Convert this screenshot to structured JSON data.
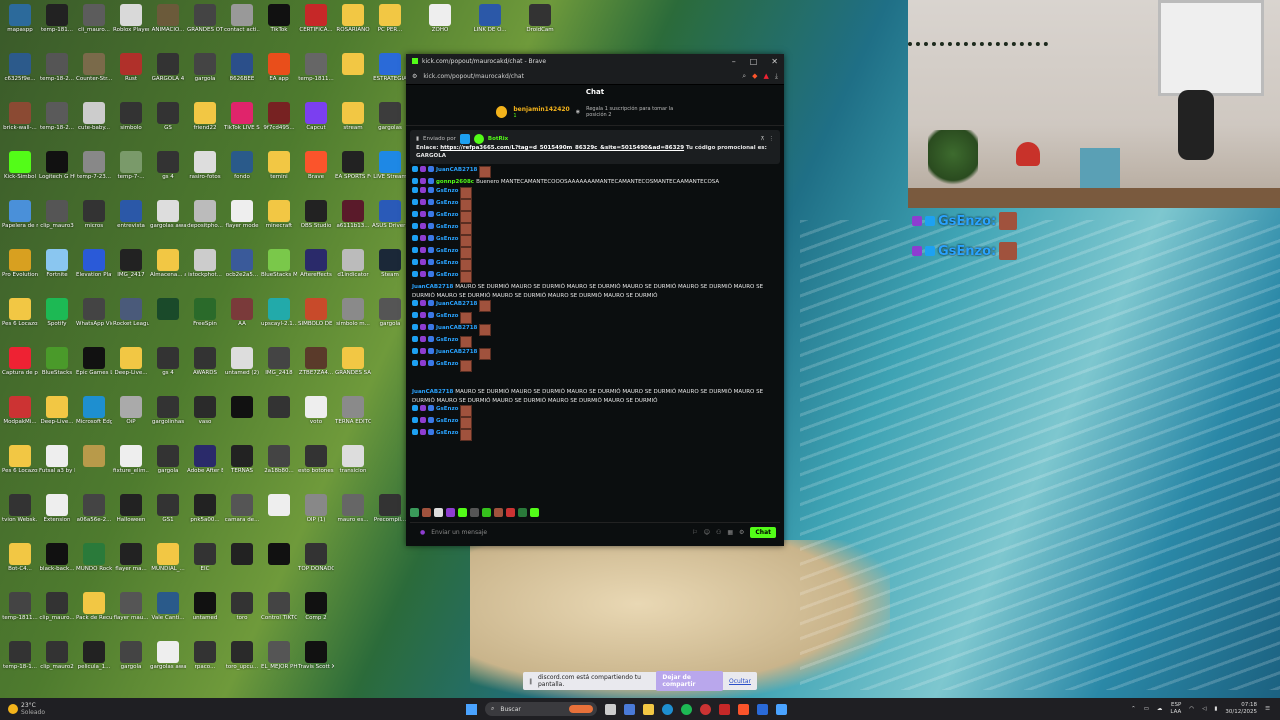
{
  "desktop_icons": [
    {
      "label": "mapaspp",
      "color": "#2c6a9b"
    },
    {
      "label": "temp-181...",
      "color": "#222"
    },
    {
      "label": "cli_mauro...",
      "color": "#5c5c5c"
    },
    {
      "label": "Roblox Player",
      "color": "#d9d9d9"
    },
    {
      "label": "ANIMACIO...",
      "color": "#6b5a3a"
    },
    {
      "label": "GRANDES OTRAS AWARD",
      "color": "#444"
    },
    {
      "label": "contact acti...",
      "color": "#999"
    },
    {
      "label": "TikTok",
      "color": "#111"
    },
    {
      "label": "CERTIFICA...",
      "color": "#c62828"
    },
    {
      "label": "ROSARIANO",
      "color": "#f2c744"
    },
    {
      "label": "PC PER...",
      "color": "#f2c744"
    },
    {
      "label": "ZOHO",
      "color": "#eee"
    },
    {
      "label": "LINK DE O...",
      "color": "#2b58a8"
    },
    {
      "label": "DroidCam",
      "color": "#333"
    },
    {
      "label": "c6325f9e...",
      "color": "#2c5a8b"
    },
    {
      "label": "temp-18-2...",
      "color": "#555"
    },
    {
      "label": "Counter-Str...",
      "color": "#7a6a4a"
    },
    {
      "label": "Rust",
      "color": "#b0302a"
    },
    {
      "label": "GARGOLA 4",
      "color": "#333"
    },
    {
      "label": "gargola",
      "color": "#444"
    },
    {
      "label": "8626BEE",
      "color": "#2b4f8a"
    },
    {
      "label": "EA app",
      "color": "#e94e1b"
    },
    {
      "label": "temp-1811...",
      "color": "#666"
    },
    {
      "label": "",
      "color": "#f2c744"
    },
    {
      "label": "ESTRATEGIA",
      "color": "#2a6ad8"
    },
    {
      "label": "brick-wall-...",
      "color": "#8b4a33"
    },
    {
      "label": "temp-18-2...",
      "color": "#5a5a5a"
    },
    {
      "label": "cute-baby...",
      "color": "#ccc"
    },
    {
      "label": "simbolo",
      "color": "#333"
    },
    {
      "label": "GS",
      "color": "#333"
    },
    {
      "label": "friend22",
      "color": "#f2c744"
    },
    {
      "label": "TikTok LIVE Studio",
      "color": "#e0246b"
    },
    {
      "label": "9f7cd495...",
      "color": "#722"
    },
    {
      "label": "Capcut",
      "color": "#7b3ff0"
    },
    {
      "label": "stream",
      "color": "#f2c744"
    },
    {
      "label": "gargolas",
      "color": "#3c3c3c"
    },
    {
      "label": "Kick-Simbol",
      "color": "#53fc18"
    },
    {
      "label": "Logitech G HUB",
      "color": "#111"
    },
    {
      "label": "temp-7-23...",
      "color": "#888"
    },
    {
      "label": "temp-7-...",
      "color": "#7a9a6a"
    },
    {
      "label": "gs 4",
      "color": "#333"
    },
    {
      "label": "rasiro-fotos",
      "color": "#ddd"
    },
    {
      "label": "fondo",
      "color": "#2a5a8a"
    },
    {
      "label": "temini",
      "color": "#f2c744"
    },
    {
      "label": "Brave",
      "color": "#fb542b"
    },
    {
      "label": "EA SPORTS FC 25",
      "color": "#222"
    },
    {
      "label": "LIVE Stream",
      "color": "#1e88e5"
    },
    {
      "label": "Papelera de reciclaje",
      "color": "#4a90d9"
    },
    {
      "label": "clip_mauro3",
      "color": "#555"
    },
    {
      "label": "micros",
      "color": "#333"
    },
    {
      "label": "entrevista",
      "color": "#2b58a8"
    },
    {
      "label": "gargolas awards",
      "color": "#ddd"
    },
    {
      "label": "depositpho...",
      "color": "#bbb"
    },
    {
      "label": "flayer mode",
      "color": "#eee"
    },
    {
      "label": "minecraft",
      "color": "#f2c744"
    },
    {
      "label": "OBS Studio",
      "color": "#222"
    },
    {
      "label": "a6111b13...",
      "color": "#5a1a2a"
    },
    {
      "label": "ASUS DriverHub",
      "color": "#2a5ab8"
    },
    {
      "label": "Pro Evolution Soccer 6",
      "color": "#d8a020"
    },
    {
      "label": "Fortnite",
      "color": "#8ac6f0"
    },
    {
      "label": "Elevation Player",
      "color": "#2a5ad8"
    },
    {
      "label": "IMG_2417",
      "color": "#222"
    },
    {
      "label": "Almacena... automatic...",
      "color": "#f2c744"
    },
    {
      "label": "istockphot...",
      "color": "#ccc"
    },
    {
      "label": "ocb2e2a5...",
      "color": "#3a5a9a"
    },
    {
      "label": "BlueStacks Multi-Insta...",
      "color": "#7ac84a"
    },
    {
      "label": "Aftereffects",
      "color": "#2a2a6a"
    },
    {
      "label": "d1indicator",
      "color": "#bbb"
    },
    {
      "label": "Steam",
      "color": "#1b2838"
    },
    {
      "label": "Pes 6 Locazos",
      "color": "#f2c744"
    },
    {
      "label": "Spotify",
      "color": "#1db954"
    },
    {
      "label": "WhatsApp Video 2025...",
      "color": "#444"
    },
    {
      "label": "Rocket League",
      "color": "#4a5a7a"
    },
    {
      "label": "",
      "color": "#1a4a2a"
    },
    {
      "label": "FreeSpin",
      "color": "#2a6a2a"
    },
    {
      "label": "AA",
      "color": "#7a3a3a"
    },
    {
      "label": "upscayl-2.1...",
      "color": "#2aa"
    },
    {
      "label": "SIMBOLO DE GARGOLA",
      "color": "#c84a2a"
    },
    {
      "label": "simbolo m...",
      "color": "#8a8a8a"
    },
    {
      "label": "gargola",
      "color": "#555"
    },
    {
      "label": "Captura de pantalla 2...",
      "color": "#e23"
    },
    {
      "label": "BlueStacks",
      "color": "#4a9a2a"
    },
    {
      "label": "Epic Games Launcher",
      "color": "#111"
    },
    {
      "label": "Deep-Live...",
      "color": "#f2c744"
    },
    {
      "label": "gs 4",
      "color": "#333"
    },
    {
      "label": "AWARDS",
      "color": "#333"
    },
    {
      "label": "untamed (2)",
      "color": "#ddd"
    },
    {
      "label": "IMG_2418",
      "color": "#444"
    },
    {
      "label": "ZTBE7ZA4...",
      "color": "#5a3a2a"
    },
    {
      "label": "GRANDES SALVAJES",
      "color": "#f2c744"
    },
    {
      "label": "ModpakMi...",
      "color": "#c33"
    },
    {
      "label": "Deep-Live...",
      "color": "#f2c744"
    },
    {
      "label": "Microsoft Edge",
      "color": "#1e8fd0"
    },
    {
      "label": "OiP",
      "color": "#aaa"
    },
    {
      "label": "gargolinhas",
      "color": "#333"
    },
    {
      "label": "vaso",
      "color": "#2a2a2a"
    },
    {
      "label": "",
      "color": "#111"
    },
    {
      "label": "",
      "color": "#333"
    },
    {
      "label": "voto",
      "color": "#eee"
    },
    {
      "label": "TERNA EDITORIA",
      "color": "#8a8a8a"
    },
    {
      "label": "Pes 6 Locazos",
      "color": "#f2c744"
    },
    {
      "label": "Futsal a3 by Bazinga Fro...",
      "color": "#eee"
    },
    {
      "label": "",
      "color": "#b89a4a"
    },
    {
      "label": "fixture_elim...",
      "color": "#eee"
    },
    {
      "label": "gargola",
      "color": "#333"
    },
    {
      "label": "Adobe After Effects",
      "color": "#2a2a6a"
    },
    {
      "label": "TERNAS",
      "color": "#222"
    },
    {
      "label": "2a18b80...",
      "color": "#444"
    },
    {
      "label": "esto botones ...",
      "color": "#333"
    },
    {
      "label": "transicion",
      "color": "#ddd"
    },
    {
      "label": "tvion Websk...",
      "color": "#333"
    },
    {
      "label": "Extension",
      "color": "#eee"
    },
    {
      "label": "a06a56e-2...",
      "color": "#444"
    },
    {
      "label": "Halloween",
      "color": "#222"
    },
    {
      "label": "GS1",
      "color": "#333"
    },
    {
      "label": "pnk5a00...",
      "color": "#222"
    },
    {
      "label": "camara de...",
      "color": "#555"
    },
    {
      "label": "",
      "color": "#eee"
    },
    {
      "label": "OIP (1)",
      "color": "#888"
    },
    {
      "label": "mauro es...",
      "color": "#666"
    },
    {
      "label": "Precompil...",
      "color": "#333"
    },
    {
      "label": "Bot-C4...",
      "color": "#f2c744"
    },
    {
      "label": "black-back...",
      "color": "#111"
    },
    {
      "label": "MUNDO Rocket...",
      "color": "#2a7a3a"
    },
    {
      "label": "flayer ma...",
      "color": "#222"
    },
    {
      "label": "MUNDIAL_...",
      "color": "#f2c744"
    },
    {
      "label": "EIC",
      "color": "#333"
    },
    {
      "label": "",
      "color": "#222"
    },
    {
      "label": "",
      "color": "#111"
    },
    {
      "label": "TOP DONADO...",
      "color": "#333"
    },
    {
      "label": "temp-1811...",
      "color": "#444"
    },
    {
      "label": "clip_mauro...",
      "color": "#333"
    },
    {
      "label": "Pack de Recursos",
      "color": "#f2c744"
    },
    {
      "label": "flayer mau...",
      "color": "#555"
    },
    {
      "label": "Vale Canti...",
      "color": "#2a5a8a"
    },
    {
      "label": "untamed",
      "color": "#111"
    },
    {
      "label": "toro",
      "color": "#333"
    },
    {
      "label": "Control TIKTOK",
      "color": "#444"
    },
    {
      "label": "Comp 2",
      "color": "#111"
    },
    {
      "label": "temp-18-1...",
      "color": "#333"
    },
    {
      "label": "clip_mauro2",
      "color": "#333"
    },
    {
      "label": "pelicula_1...",
      "color": "#222"
    },
    {
      "label": "gargola",
      "color": "#444"
    },
    {
      "label": "gargolas awards",
      "color": "#eee"
    },
    {
      "label": "rpaco...",
      "color": "#333"
    },
    {
      "label": "toro_upcu...",
      "color": "#2a2a2a"
    },
    {
      "label": "EL_MEJOR PHONE",
      "color": "#555"
    },
    {
      "label": "Travis Scott X Jordan...",
      "color": "#111"
    }
  ],
  "browser": {
    "title": "kick.com/popout/maurocakd/chat - Brave",
    "url": "kick.com/popout/maurocakd/chat",
    "chat_title": "Chat",
    "sub_user": "benjamin142420",
    "sub_count": "1",
    "sub_text": "Regala 1 suscripción para tomar la posición 2",
    "pinned": {
      "sent_by": "Enviado por",
      "bot_name": "BotRix",
      "prefix": "Enlace:",
      "link": "https://refpa3665.com/L?tag=d_5015490m_86329c_&site=5015490&ad=86329",
      "suffix": "Tu código promocional es: GARGOLA"
    },
    "messages": [
      {
        "user": "JuanCAB2718",
        "text": "",
        "emotes": 1
      },
      {
        "user": "gonnp2608c",
        "text": "Buenero MANTECAMANTECOOOSAAAAAAAMANTECAMANTECOSMANTECAAMANTECOSA",
        "green": true
      },
      {
        "user": "GsEnzo",
        "text": "",
        "emotes": 1
      },
      {
        "user": "GsEnzo",
        "text": "",
        "emotes": 1
      },
      {
        "user": "GsEnzo",
        "text": "",
        "emotes": 1
      },
      {
        "user": "GsEnzo",
        "text": "",
        "emotes": 1
      },
      {
        "user": "GsEnzo",
        "text": "",
        "emotes": 1
      },
      {
        "user": "GsEnzo",
        "text": "",
        "emotes": 1
      },
      {
        "user": "GsEnzo",
        "text": "",
        "emotes": 1
      },
      {
        "user": "GsEnzo",
        "text": "",
        "emotes": 1
      }
    ],
    "spam1": {
      "user": "JuanCAB2718",
      "text": "MAURO SE DURMIÓ  MAURO SE DURMIÓ  MAURO SE DURMIÓ  MAURO SE DURMIÓ  MAURO SE DURMIÓ  MAURO SE DURMIÓ  MAURO SE DURMIÓ  MAURO SE DURMIÓ  MAURO SE DURMIÓ  MAURO SE DURMIÓ"
    },
    "messages2": [
      {
        "user": "JuanCAB2718",
        "text": "",
        "emotes": 1
      },
      {
        "user": "GsEnzo",
        "text": "",
        "emotes": 1
      },
      {
        "user": "JuanCAB2718",
        "text": "",
        "emotes": 1
      },
      {
        "user": "GsEnzo",
        "text": "",
        "emotes": 1
      },
      {
        "user": "JuanCAB2718",
        "text": "",
        "emotes": 1
      },
      {
        "user": "GsEnzo",
        "text": "",
        "emotes": 1
      }
    ],
    "spam2": {
      "user": "JuanCAB2718",
      "text": "MAURO SE DURMIÓ  MAURO SE DURMIÓ  MAURO SE DURMIÓ  MAURO SE DURMIÓ  MAURO SE DURMIÓ  MAURO SE DURMIÓ  MAURO SE DURMIÓ  MAURO SE DURMIÓ  MAURO SE DURMIÓ  MAURO SE DURMIÓ"
    },
    "messages3": [
      {
        "user": "GsEnzo",
        "text": "",
        "emotes": 1
      },
      {
        "user": "GsEnzo",
        "text": "",
        "emotes": 1
      },
      {
        "user": "GsEnzo",
        "text": "",
        "emotes": 1
      }
    ],
    "input_placeholder": "Enviar un mensaje",
    "send_label": "Chat"
  },
  "overlay_names": [
    "GsEnzo:",
    "GsEnzo:"
  ],
  "share_bar": {
    "text": "discord.com está compartiendo tu pantalla.",
    "stop_label": "Dejar de compartir",
    "hide_label": "Ocultar"
  },
  "taskbar": {
    "temp": "23°C",
    "weather": "Soleado",
    "search_label": "Buscar",
    "lang_line1": "ESP",
    "lang_line2": "LAA",
    "time": "07:18",
    "date": "30/12/2025"
  }
}
